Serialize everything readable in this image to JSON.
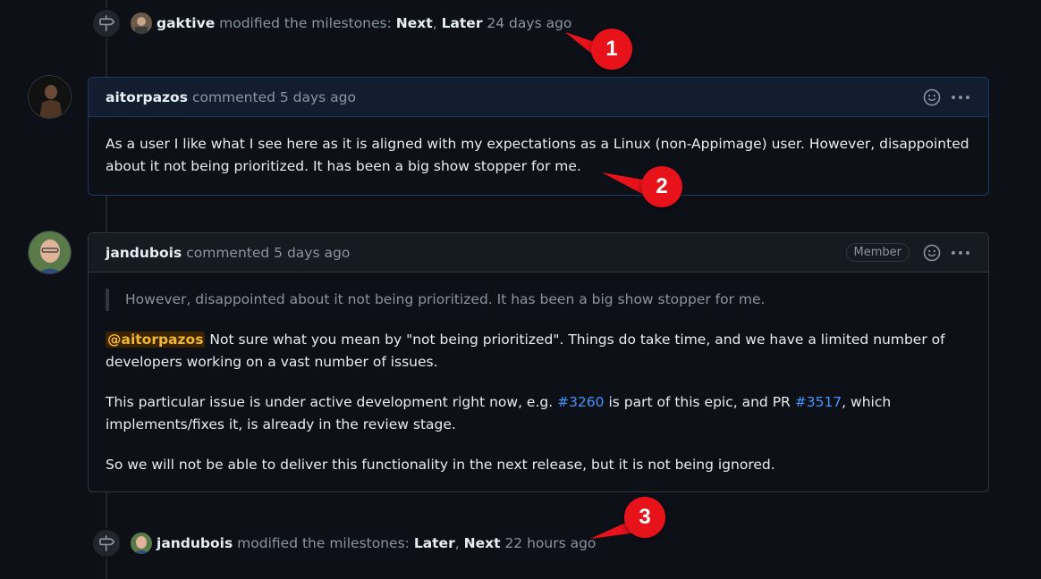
{
  "event1": {
    "author": "gaktive",
    "action": "modified the milestones:",
    "milestone_a": "Next",
    "separator": ",",
    "milestone_b": "Later",
    "time": "24 days ago",
    "icon": "milestone-icon"
  },
  "comment1": {
    "author": "aitorpazos",
    "meta": "commented 5 days ago",
    "body": "As a user I like what I see here as it is aligned with my expectations as a Linux (non-Appimage) user. However, disappointed about it not being prioritized. It has been a big show stopper for me."
  },
  "comment2": {
    "author": "jandubois",
    "meta": "commented 5 days ago",
    "badge": "Member",
    "quote": "However, disappointed about it not being prioritized. It has been a big show stopper for me.",
    "p1_mention": "@aitorpazos",
    "p1_rest": " Not sure what you mean by \"not being prioritized\". Things do take time, and we have a limited number of developers working on a vast number of issues.",
    "p2_a": "This particular issue is under active development right now, e.g. ",
    "p2_link1": "#3260",
    "p2_b": " is part of this epic, and PR ",
    "p2_link2": "#3517",
    "p2_c": ", which implements/fixes it, is already in the review stage.",
    "p3": "So we will not be able to deliver this functionality in the next release, but it is not being ignored."
  },
  "event2": {
    "author": "jandubois",
    "action": "modified the milestones:",
    "milestone_a": "Later",
    "separator": ",",
    "milestone_b": "Next",
    "time": "22 hours ago",
    "icon": "milestone-icon"
  },
  "callouts": [
    "1",
    "2",
    "3"
  ],
  "colors": {
    "background": "#0d1117",
    "border": "#30363d",
    "link": "#4493f8",
    "callout": "#e8121b",
    "mention_bg": "#3b2300",
    "mention_fg": "#f0b72f"
  }
}
